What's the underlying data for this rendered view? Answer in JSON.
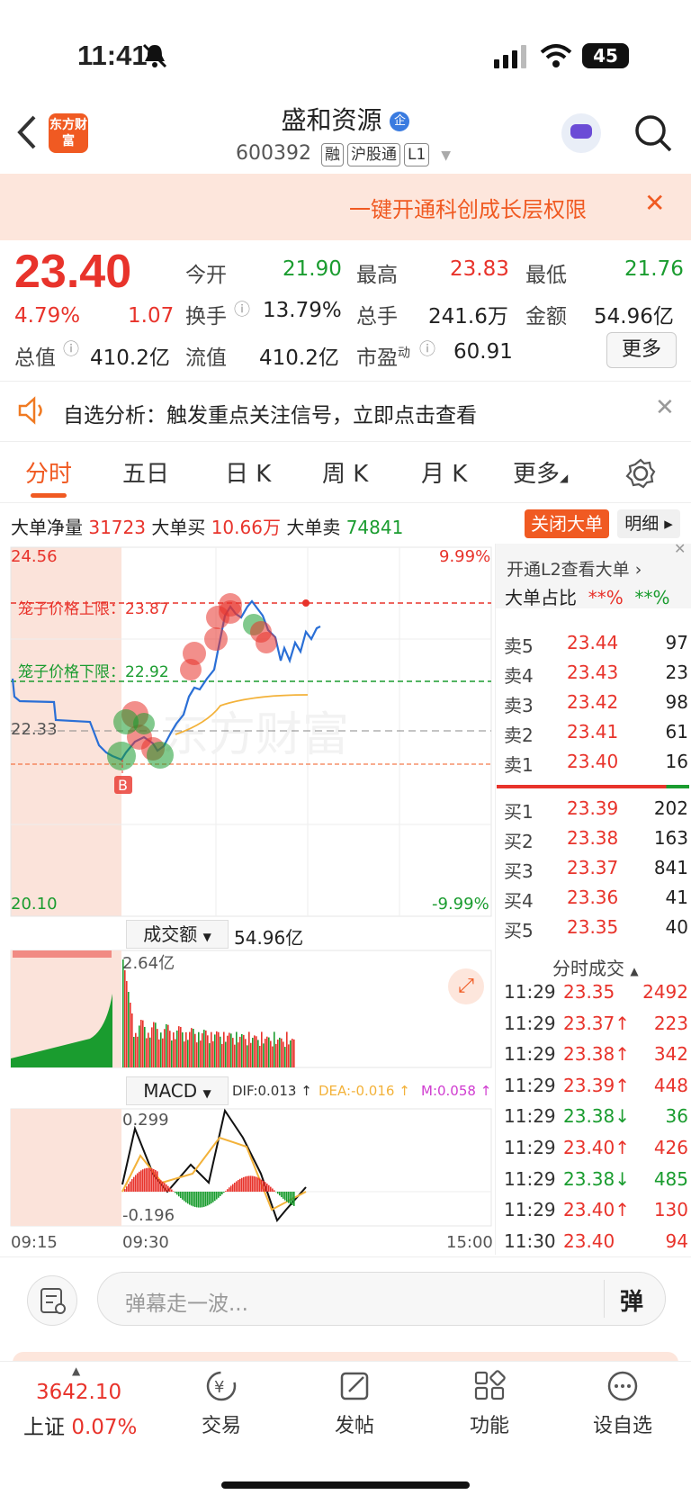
{
  "status_bar": {
    "time": "11:41",
    "battery": "45"
  },
  "header": {
    "back_icon": "back-arrow-icon",
    "logo_text": "东方财富",
    "stock_name": "盛和资源",
    "badge": "企",
    "code": "600392",
    "tags": [
      "融",
      "沪股通",
      "L1"
    ]
  },
  "banner": {
    "text": "一键开通科创成长层权限",
    "close": "✕"
  },
  "quote": {
    "price": "23.40",
    "change_pct": "4.79%",
    "change": "1.07",
    "open_label": "今开",
    "open": "21.90",
    "high_label": "最高",
    "high": "23.83",
    "low_label": "最低",
    "low": "21.76",
    "turnover_label": "换手",
    "turnover": "13.79%",
    "volume_label": "总手",
    "volume": "241.6万",
    "amount_label": "金额",
    "amount": "54.96亿",
    "mktcap_label": "总值",
    "mktcap": "410.2亿",
    "float_label": "流值",
    "float": "410.2亿",
    "pe_label": "市盈",
    "pe_sup": "动",
    "pe": "60.91",
    "more_button": "更多"
  },
  "alert": {
    "text": "自选分析：触发重点关注信号，立即点击查看"
  },
  "tabs": [
    "分时",
    "五日",
    "日 K",
    "周 K",
    "月 K",
    "更多"
  ],
  "bigorder": {
    "net_label": "大单净量",
    "net": "31723",
    "buy_label": "大单买",
    "buy": "10.66万",
    "sell_label": "大单卖",
    "sell": "74841",
    "close_button": "关闭大单",
    "detail_button": "明细"
  },
  "intraday": {
    "top_price": "24.56",
    "top_pct": "9.99%",
    "bottom_price": "20.10",
    "bottom_pct": "-9.99%",
    "mid_price": "22.33",
    "upper_limit": "笼子价格上限：23.87",
    "lower_limit": "笼子价格下限：22.92",
    "watermark": "东方财富",
    "marker": "B"
  },
  "volume_panel": {
    "label": "成交额",
    "value": "54.96亿",
    "max": "2.64亿"
  },
  "macd_panel": {
    "label": "MACD",
    "dif": "DIF:0.013 ↑",
    "dea": "DEA:-0.016 ↑",
    "m": "M:0.058 ↑",
    "max": "0.299",
    "min": "-0.196"
  },
  "time_axis": [
    "09:15",
    "09:30",
    "15:00"
  ],
  "l2": {
    "promo": "开通L2查看大单",
    "ratio_label": "大单占比",
    "ratio_a": "**%",
    "ratio_b": "**%"
  },
  "asks": [
    {
      "label": "卖5",
      "price": "23.44",
      "vol": "97"
    },
    {
      "label": "卖4",
      "price": "23.43",
      "vol": "23"
    },
    {
      "label": "卖3",
      "price": "23.42",
      "vol": "98"
    },
    {
      "label": "卖2",
      "price": "23.41",
      "vol": "61"
    },
    {
      "label": "卖1",
      "price": "23.40",
      "vol": "16"
    }
  ],
  "bids": [
    {
      "label": "买1",
      "price": "23.39",
      "vol": "202"
    },
    {
      "label": "买2",
      "price": "23.38",
      "vol": "163"
    },
    {
      "label": "买3",
      "price": "23.37",
      "vol": "841"
    },
    {
      "label": "买4",
      "price": "23.36",
      "vol": "41"
    },
    {
      "label": "买5",
      "price": "23.35",
      "vol": "40"
    }
  ],
  "ticks_label": "分时成交",
  "ticks": [
    {
      "time": "11:29",
      "price": "23.35",
      "vol": "2492",
      "dir": "",
      "color": "#e8332b"
    },
    {
      "time": "11:29",
      "price": "23.37↑",
      "vol": "223",
      "dir": "up",
      "color": "#e8332b"
    },
    {
      "time": "11:29",
      "price": "23.38↑",
      "vol": "342",
      "dir": "up",
      "color": "#e8332b"
    },
    {
      "time": "11:29",
      "price": "23.39↑",
      "vol": "448",
      "dir": "up",
      "color": "#e8332b"
    },
    {
      "time": "11:29",
      "price": "23.38↓",
      "vol": "36",
      "dir": "down",
      "color": "#1a9c2f"
    },
    {
      "time": "11:29",
      "price": "23.40↑",
      "vol": "426",
      "dir": "up",
      "color": "#e8332b"
    },
    {
      "time": "11:29",
      "price": "23.38↓",
      "vol": "485",
      "dir": "down",
      "color": "#1a9c2f"
    },
    {
      "time": "11:29",
      "price": "23.40↑",
      "vol": "130",
      "dir": "up",
      "color": "#e8332b"
    },
    {
      "time": "11:30",
      "price": "23.40",
      "vol": "94",
      "dir": "",
      "color": "#e8332b"
    }
  ],
  "comment": {
    "placeholder": "弹幕走一波...",
    "danmu": "弹"
  },
  "nav": {
    "index_value": "3642.10",
    "index_name": "上证",
    "index_pct": "0.07%",
    "items": [
      "交易",
      "发帖",
      "功能",
      "设自选"
    ]
  },
  "colors": {
    "up": "#e8332b",
    "down": "#1a9c2f",
    "accent": "#f07a22"
  }
}
